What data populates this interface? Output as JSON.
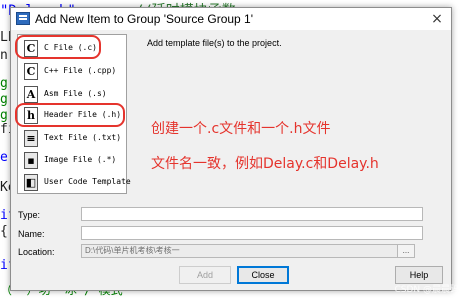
{
  "editor": {
    "top_line_code": "\"Delay.h\"",
    "top_line_comment": "//延时模块函数",
    "bottom_line": "（ -）功  冰 /*模式",
    "left_fragments": [
      "LE",
      "n",
      "gr",
      "gr",
      "gr",
      "fi",
      "e",
      "Ke",
      "if",
      "{",
      "if"
    ]
  },
  "dialog": {
    "title": "Add New Item to Group 'Source Group 1'",
    "close_glyph": "×",
    "description": "Add template file(s) to the project.",
    "templates": [
      {
        "icon": "C",
        "label": "C File (.c)"
      },
      {
        "icon": "C",
        "label": "C++ File (.cpp)"
      },
      {
        "icon": "A",
        "label": "Asm File (.s)"
      },
      {
        "icon": "h",
        "label": "Header File (.h)"
      },
      {
        "icon": "≡",
        "label": "Text File (.txt)"
      },
      {
        "icon": "▪",
        "label": "Image File (.*)"
      },
      {
        "icon": "◧",
        "label": "User Code Template"
      }
    ],
    "form": {
      "type_label": "Type:",
      "type_value": "",
      "name_label": "Name:",
      "name_value": "",
      "location_label": "Location:",
      "location_value": "D:\\代码\\单片机考核\\考核一",
      "browse_label": "..."
    },
    "buttons": {
      "add": "Add",
      "close": "Close",
      "help": "Help"
    }
  },
  "annotations": {
    "line1": "创建一个.c文件和一个.h文件",
    "line2": "文件名一致，例如Delay.c和Delay.h",
    "color": "#e5342d"
  },
  "watermark": "CSDN @晨晨码影"
}
